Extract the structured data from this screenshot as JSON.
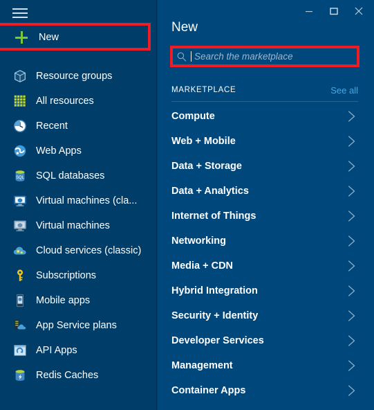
{
  "window": {
    "controls": [
      {
        "name": "minimize-button",
        "glyph": "minimize"
      },
      {
        "name": "maximize-button",
        "glyph": "maximize"
      },
      {
        "name": "close-button",
        "glyph": "close"
      }
    ]
  },
  "sidebar": {
    "menu_icon": "hamburger-icon",
    "new": {
      "label": "New",
      "icon": "plus-icon",
      "highlighted": true,
      "highlight_color": "#ee1c25"
    },
    "items": [
      {
        "label": "Resource groups",
        "icon": "resource-groups-icon"
      },
      {
        "label": "All resources",
        "icon": "all-resources-grid-icon"
      },
      {
        "label": "Recent",
        "icon": "clock-icon"
      },
      {
        "label": "Web Apps",
        "icon": "web-apps-globe-icon"
      },
      {
        "label": "SQL databases",
        "icon": "sql-database-icon"
      },
      {
        "label": "Virtual machines (cla...",
        "icon": "virtual-machine-classic-icon"
      },
      {
        "label": "Virtual machines",
        "icon": "virtual-machine-icon"
      },
      {
        "label": "Cloud services (classic)",
        "icon": "cloud-services-icon"
      },
      {
        "label": "Subscriptions",
        "icon": "key-icon"
      },
      {
        "label": "Mobile apps",
        "icon": "mobile-phone-icon"
      },
      {
        "label": "App Service plans",
        "icon": "app-service-plan-icon"
      },
      {
        "label": "API Apps",
        "icon": "api-apps-icon"
      },
      {
        "label": "Redis Caches",
        "icon": "redis-cache-icon"
      }
    ]
  },
  "panel": {
    "title": "New",
    "search": {
      "placeholder": "Search the marketplace",
      "value": "",
      "icon": "search-icon",
      "highlighted": true,
      "highlight_color": "#ee1c25"
    },
    "marketplace": {
      "heading": "MARKETPLACE",
      "see_all": "See all",
      "items": [
        {
          "label": "Compute",
          "icon": "chevron-right-icon"
        },
        {
          "label": "Web + Mobile",
          "icon": "chevron-right-icon"
        },
        {
          "label": "Data + Storage",
          "icon": "chevron-right-icon"
        },
        {
          "label": "Data + Analytics",
          "icon": "chevron-right-icon"
        },
        {
          "label": "Internet of Things",
          "icon": "chevron-right-icon"
        },
        {
          "label": "Networking",
          "icon": "chevron-right-icon"
        },
        {
          "label": "Media + CDN",
          "icon": "chevron-right-icon"
        },
        {
          "label": "Hybrid Integration",
          "icon": "chevron-right-icon"
        },
        {
          "label": "Security + Identity",
          "icon": "chevron-right-icon"
        },
        {
          "label": "Developer Services",
          "icon": "chevron-right-icon"
        },
        {
          "label": "Management",
          "icon": "chevron-right-icon"
        },
        {
          "label": "Container Apps",
          "icon": "chevron-right-icon"
        }
      ]
    }
  },
  "colors": {
    "sidebar_bg": "#003d68",
    "panel_bg": "#00477c",
    "accent_green": "#7cc832",
    "link_blue": "#4aa7e0",
    "highlight_red": "#ee1c25"
  }
}
